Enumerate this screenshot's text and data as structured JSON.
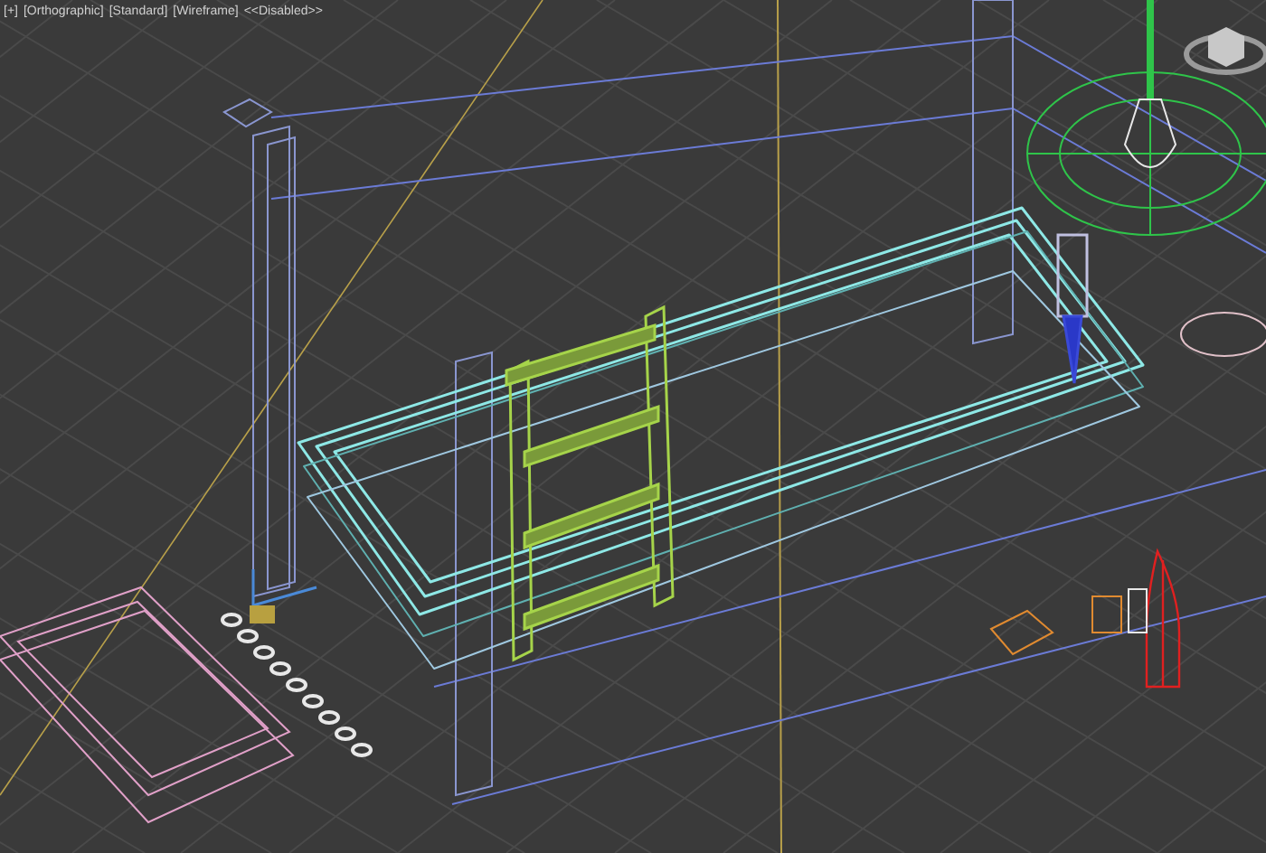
{
  "viewport": {
    "labels": [
      {
        "text": "[+]"
      },
      {
        "text": "[Orthographic]"
      },
      {
        "text": "[Standard]"
      },
      {
        "text": "[Wireframe]"
      },
      {
        "text": "<<Disabled>>"
      }
    ]
  }
}
